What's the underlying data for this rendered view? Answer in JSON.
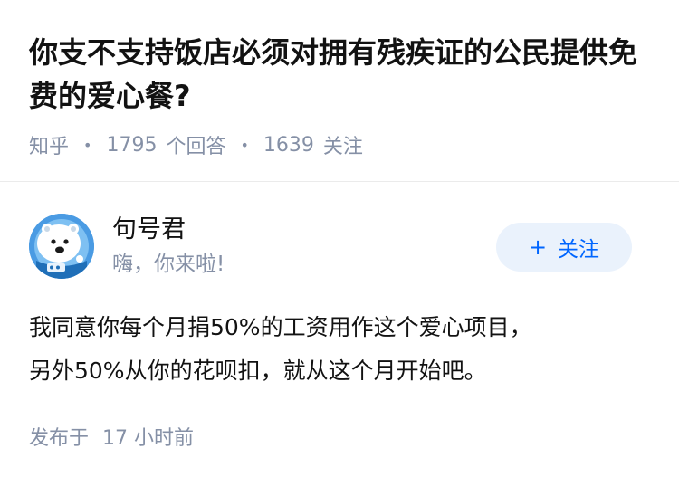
{
  "question": {
    "title": "你支不支持饭店必须对拥有残疾证的公民提供免费的爱心餐?",
    "source": "知乎",
    "answer_count": "1795",
    "answer_count_label": "个回答",
    "follower_count": "1639",
    "follower_count_label": "关注"
  },
  "author": {
    "name": "句号君",
    "bio": "嗨，你来啦!",
    "follow_label": "关注",
    "follow_icon": "plus-icon",
    "avatar_icon": "polar-bear-astronaut-avatar"
  },
  "answer": {
    "lines": [
      "我同意你每个月捐50%的工资用作这个爱心项目，",
      "另外50%从你的花呗扣，就从这个月开始吧。"
    ],
    "time_label": "发布于",
    "time_value": "17 小时前"
  },
  "colors": {
    "text": "#121212",
    "meta": "#8590a6",
    "accent": "#0066ff",
    "follow_bg": "#eaf2fc",
    "avatar_bg": "#4a9be3"
  }
}
